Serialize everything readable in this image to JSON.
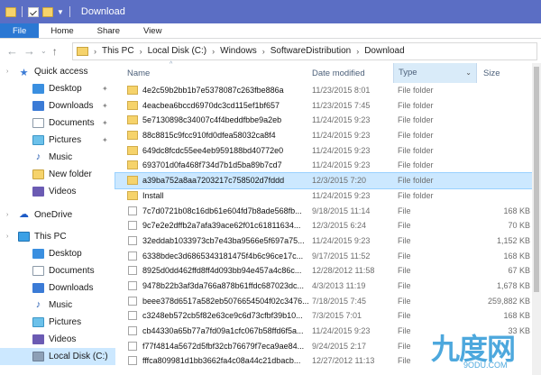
{
  "window": {
    "title": "Download"
  },
  "ribbon": {
    "tabs": [
      "File",
      "Home",
      "Share",
      "View"
    ]
  },
  "address": {
    "crumbs": [
      "This PC",
      "Local Disk (C:)",
      "Windows",
      "SoftwareDistribution",
      "Download"
    ]
  },
  "nav": {
    "items": [
      {
        "label": "Quick access",
        "icon": "star-icon"
      },
      {
        "label": "Desktop",
        "icon": "desktop-icon",
        "pinned": true
      },
      {
        "label": "Downloads",
        "icon": "download-icon",
        "pinned": true
      },
      {
        "label": "Documents",
        "icon": "document-icon",
        "pinned": true
      },
      {
        "label": "Pictures",
        "icon": "pictures-icon",
        "pinned": true
      },
      {
        "label": "Music",
        "icon": "music-icon"
      },
      {
        "label": "New folder",
        "icon": "folder-icon"
      },
      {
        "label": "Videos",
        "icon": "videos-icon"
      },
      {
        "label": "OneDrive",
        "icon": "cloud-icon"
      },
      {
        "label": "This PC",
        "icon": "pc-icon"
      },
      {
        "label": "Desktop",
        "icon": "desktop-icon"
      },
      {
        "label": "Documents",
        "icon": "document-icon"
      },
      {
        "label": "Downloads",
        "icon": "download-icon"
      },
      {
        "label": "Music",
        "icon": "music-icon"
      },
      {
        "label": "Pictures",
        "icon": "pictures-icon"
      },
      {
        "label": "Videos",
        "icon": "videos-icon"
      },
      {
        "label": "Local Disk (C:)",
        "icon": "drive-icon",
        "selected": true
      }
    ]
  },
  "columns": {
    "name": "Name",
    "date": "Date modified",
    "type": "Type",
    "size": "Size"
  },
  "files": [
    {
      "name": "4e2c59b2bb1b7e5378087c263fbe886a",
      "date": "11/23/2015 8:01",
      "type": "File folder",
      "size": "",
      "kind": "folder"
    },
    {
      "name": "4eacbea6bccd6970dc3cd115ef1bf657",
      "date": "11/23/2015 7:45",
      "type": "File folder",
      "size": "",
      "kind": "folder"
    },
    {
      "name": "5e7130898c34007c4f4beddfbbe9a2eb",
      "date": "11/24/2015 9:23",
      "type": "File folder",
      "size": "",
      "kind": "folder"
    },
    {
      "name": "88c8815c9fcc910fd0dfea58032ca8f4",
      "date": "11/24/2015 9:23",
      "type": "File folder",
      "size": "",
      "kind": "folder"
    },
    {
      "name": "649dc8fcdc55ee4eb959188bd40772e0",
      "date": "11/24/2015 9:23",
      "type": "File folder",
      "size": "",
      "kind": "folder"
    },
    {
      "name": "693701d0fa468f734d7b1d5ba89b7cd7",
      "date": "11/24/2015 9:23",
      "type": "File folder",
      "size": "",
      "kind": "folder"
    },
    {
      "name": "a39ba752a8aa7203217c758502d7fddd",
      "date": "12/3/2015 7:20",
      "type": "File folder",
      "size": "",
      "kind": "folder",
      "selected": true
    },
    {
      "name": "Install",
      "date": "11/24/2015 9:23",
      "type": "File folder",
      "size": "",
      "kind": "folder"
    },
    {
      "name": "7c7d0721b08c16db61e604fd7b8ade568fb...",
      "date": "9/18/2015 11:14",
      "type": "File",
      "size": "168 KB",
      "kind": "file"
    },
    {
      "name": "9c7e2e2dffb2a7afa39ace62f01c61811634...",
      "date": "12/3/2015 6:24",
      "type": "File",
      "size": "70 KB",
      "kind": "file"
    },
    {
      "name": "32eddab1033973cb7e43ba9566e5f697a75...",
      "date": "11/24/2015 9:23",
      "type": "File",
      "size": "1,152 KB",
      "kind": "file"
    },
    {
      "name": "6338bdec3d6865343181475f4b6c96ce17c...",
      "date": "9/17/2015 11:52",
      "type": "File",
      "size": "168 KB",
      "kind": "file"
    },
    {
      "name": "8925d0dd462ffd8ff4d093bb94e457a4c86c...",
      "date": "12/28/2012 11:58",
      "type": "File",
      "size": "67 KB",
      "kind": "file"
    },
    {
      "name": "9478b22b3af3da766a878b61ffdc687023dc...",
      "date": "4/3/2013 11:19",
      "type": "File",
      "size": "1,678 KB",
      "kind": "file"
    },
    {
      "name": "beee378d6517a582eb5076654504f02c3476...",
      "date": "7/18/2015 7:45",
      "type": "File",
      "size": "259,882 KB",
      "kind": "file"
    },
    {
      "name": "c3248eb572cb5f82e63ce9c6d73cfbf39b10...",
      "date": "7/3/2015 7:01",
      "type": "File",
      "size": "168 KB",
      "kind": "file"
    },
    {
      "name": "cb44330a65b77a7fd09a1cfc067b58ffd6f5a...",
      "date": "11/24/2015 9:23",
      "type": "File",
      "size": "33 KB",
      "kind": "file"
    },
    {
      "name": "f77f4814a5672d5fbf32cb76679f7eca9ae84...",
      "date": "9/24/2015 2:17",
      "type": "File",
      "size": "",
      "kind": "file"
    },
    {
      "name": "fffca809981d1bb3662fa4c08a44c21dbacb...",
      "date": "12/27/2012 11:13",
      "type": "File",
      "size": "",
      "kind": "file"
    }
  ],
  "watermark": {
    "logo": "九度网",
    "sub": "9ODU.COM"
  }
}
